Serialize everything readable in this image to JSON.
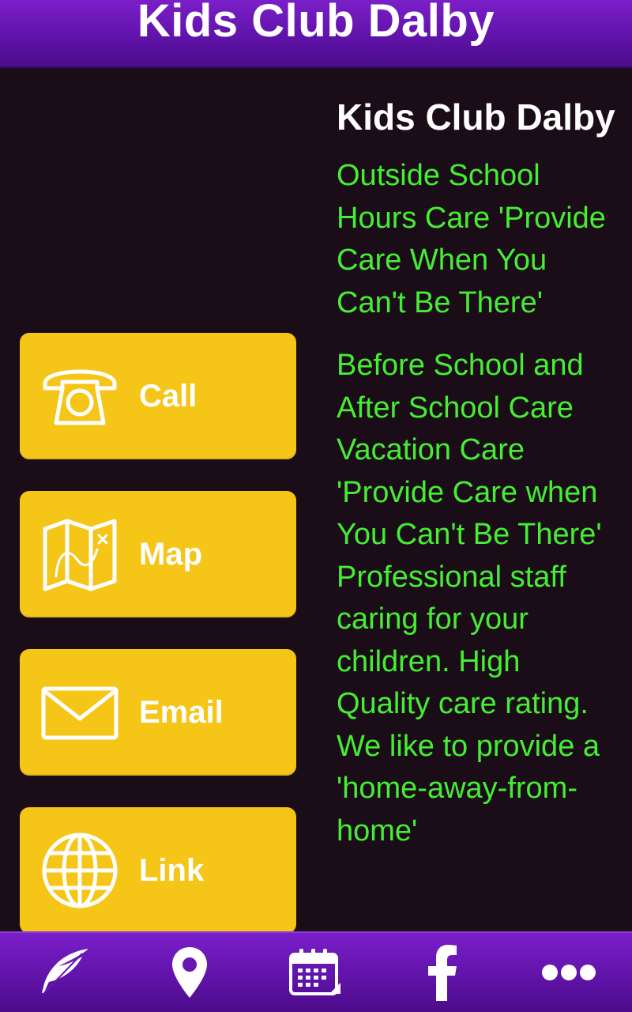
{
  "header": {
    "title": "Kids Club Dalby"
  },
  "actions": [
    {
      "label": "Call",
      "icon": "telephone-icon"
    },
    {
      "label": "Map",
      "icon": "map-icon"
    },
    {
      "label": "Email",
      "icon": "envelope-icon"
    },
    {
      "label": "Link",
      "icon": "globe-icon"
    }
  ],
  "content": {
    "title": "Kids Club Dalby",
    "paragraphs": [
      "Outside School Hours Care 'Provide Care When You Can't Be There'",
      "Before School and After School Care Vacation Care 'Provide Care when You Can't Be There' Professional staff caring for your children. High Quality care rating. We like to provide a 'home-away-from-home'"
    ]
  },
  "tabbar": {
    "tabs": [
      {
        "icon": "feather-icon"
      },
      {
        "icon": "location-pin-icon"
      },
      {
        "icon": "calendar-icon"
      },
      {
        "icon": "facebook-icon"
      },
      {
        "icon": "more-icon"
      }
    ]
  },
  "colors": {
    "accent_purple": "#6a16b5",
    "button_yellow": "#f5c518",
    "text_green": "#44ee33",
    "background": "#1b0d17"
  }
}
